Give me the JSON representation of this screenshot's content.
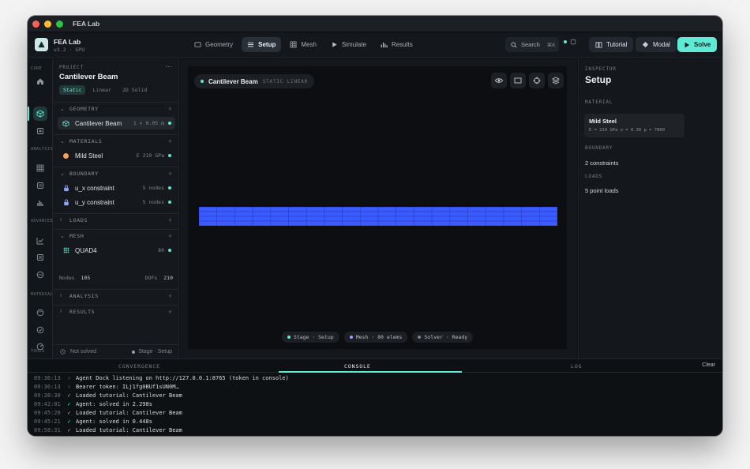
{
  "window": {
    "title": "FEA Lab"
  },
  "app": {
    "name": "FEA Lab",
    "version": "v3.2 · GPU"
  },
  "tabs": [
    {
      "label": "Geometry",
      "icon": "square-icon",
      "active": false
    },
    {
      "label": "Setup",
      "icon": "list-icon",
      "active": true
    },
    {
      "label": "Mesh",
      "icon": "grid-icon",
      "active": false
    },
    {
      "label": "Simulate",
      "icon": "play-icon",
      "active": false
    },
    {
      "label": "Results",
      "icon": "bar-chart-icon",
      "active": false
    }
  ],
  "search": {
    "label": "Search",
    "shortcut": "⌘K"
  },
  "buttons": {
    "tutorial": "Tutorial",
    "modal": "Modal",
    "solve": "Solve"
  },
  "rail": {
    "sections": [
      "CORE",
      "ANALYSIS",
      "ADVANCED",
      "MATERIALS",
      "TOOLS"
    ]
  },
  "project": {
    "label": "PROJECT",
    "title": "Cantilever Beam",
    "chips": [
      "Static",
      "Linear",
      "2D Solid"
    ]
  },
  "tree": {
    "geometry": {
      "label": "GEOMETRY",
      "item": "Cantilever Beam",
      "meta": "1 × 0.05 m"
    },
    "materials": {
      "label": "MATERIALS",
      "item": "Mild Steel",
      "meta": "E 210 GPa"
    },
    "boundary": {
      "label": "BOUNDARY",
      "items": [
        {
          "label": "u_x constraint",
          "meta": "5 nodes"
        },
        {
          "label": "u_y constraint",
          "meta": "5 nodes"
        }
      ]
    },
    "loads": {
      "label": "LOADS"
    },
    "mesh": {
      "label": "MESH",
      "item": "QUAD4",
      "meta": "80",
      "nodes_label": "Nodes",
      "nodes": "105",
      "dofs_label": "DOFs",
      "dofs": "210"
    },
    "analysis": {
      "label": "ANALYSIS"
    },
    "results": {
      "label": "RESULTS"
    },
    "footer": {
      "status": "Not solved",
      "stage": "Stage · Setup"
    }
  },
  "viewport": {
    "title": "Cantilever Beam",
    "subtitle": "STATIC LINEAR",
    "beam_color": "#3b5bff",
    "status": [
      "Stage · Setup",
      "Mesh · 80 elems",
      "Solver · Ready"
    ]
  },
  "inspector": {
    "label": "INSPECTOR",
    "title": "Setup",
    "material_label": "MATERIAL",
    "material_name": "Mild Steel",
    "material_props": "E = 210 GPa   ν = 0.30   ρ = 7800",
    "boundary_label": "BOUNDARY",
    "boundary_value": "2 constraints",
    "loads_label": "LOADS",
    "loads_value": "5 point loads"
  },
  "bottom": {
    "tabs": [
      "CONVERGENCE",
      "CONSOLE",
      "LOG"
    ],
    "clear": "Clear",
    "log": [
      {
        "ts": "09:36:13",
        "mark": "›",
        "msg": "Agent Dock listening on http://127.0.0.1:8765 (token in console)"
      },
      {
        "ts": "09:36:13",
        "mark": "›",
        "msg": "Bearer token: ILj1fg0BUf1sUN0M…"
      },
      {
        "ts": "09:38:30",
        "mark": "✓",
        "msg": "Loaded tutorial: Cantilever Beam"
      },
      {
        "ts": "09:42:01",
        "mark": "✓",
        "msg": "Agent: solved in 2.298s"
      },
      {
        "ts": "09:45:20",
        "mark": "✓",
        "msg": "Loaded tutorial: Cantilever Beam"
      },
      {
        "ts": "09:45:21",
        "mark": "✓",
        "msg": "Agent: solved in 0.448s"
      },
      {
        "ts": "09:58:31",
        "mark": "✓",
        "msg": "Loaded tutorial: Cantilever Beam"
      }
    ]
  },
  "colors": {
    "accent": "#5eead4",
    "beam": "#3b5bff",
    "material_dot": "#f4a261"
  }
}
